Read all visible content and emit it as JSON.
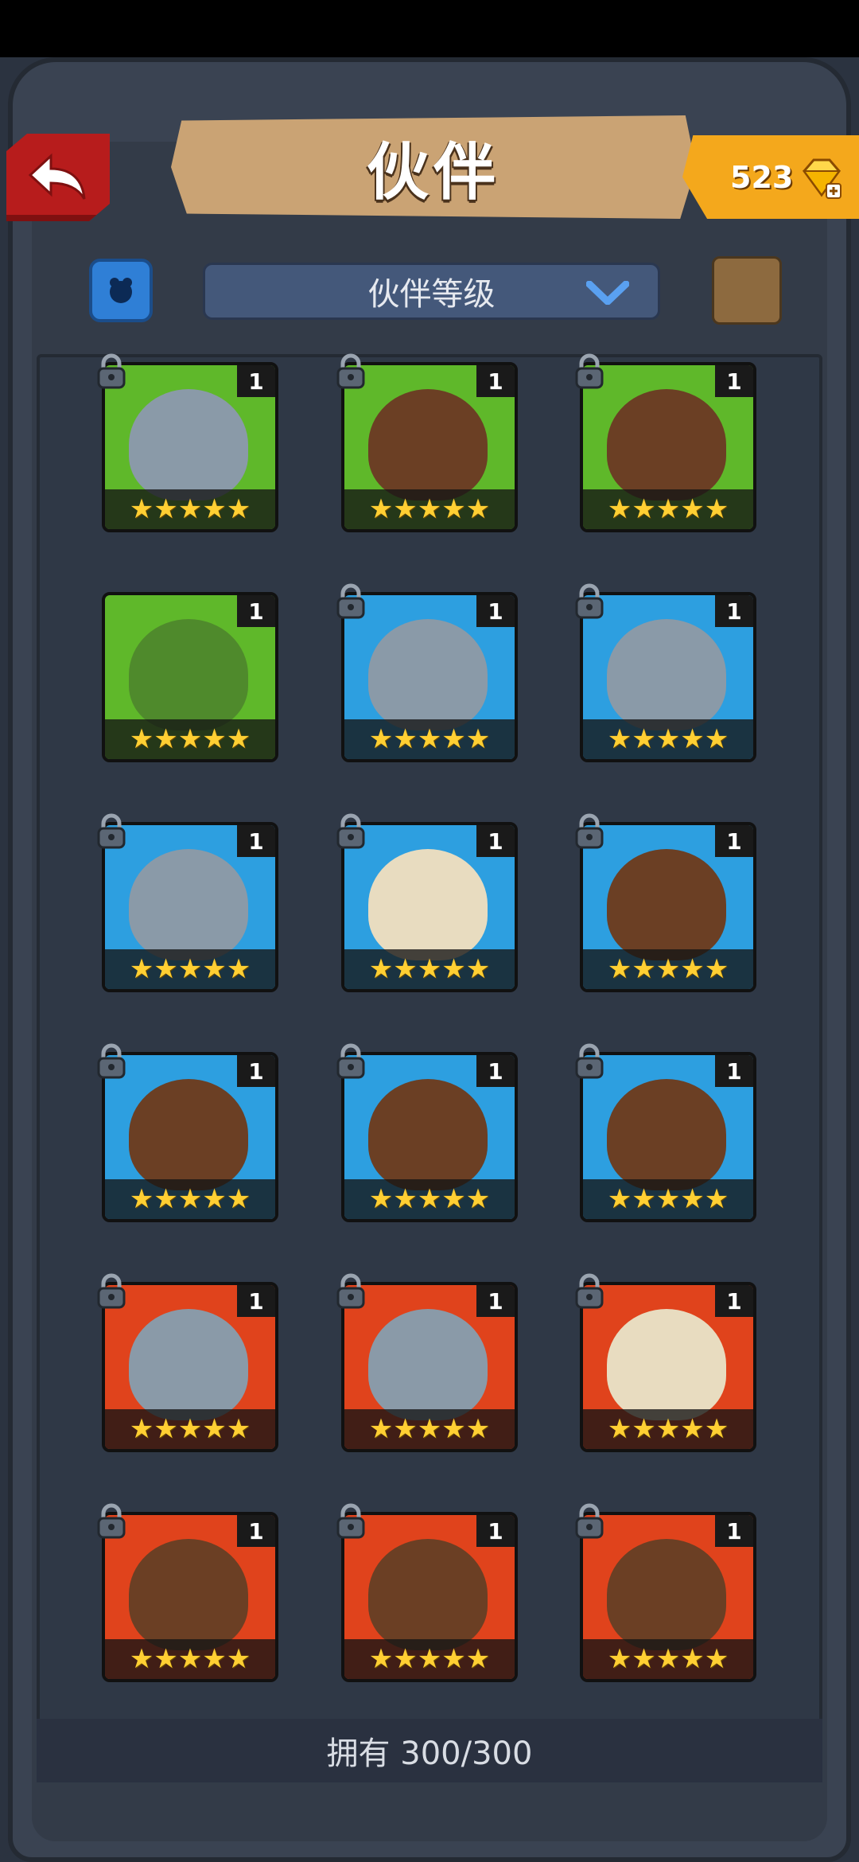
{
  "header": {
    "title": "伙伴",
    "gem_count": "523"
  },
  "filter": {
    "dropdown_label": "伙伴等级"
  },
  "colors": {
    "green": "#5fb82a",
    "blue": "#2d9fe0",
    "red": "#e0431c",
    "star": "#ffcf33"
  },
  "cards": [
    {
      "level": "1",
      "stars": "★★★★★",
      "bg": "green",
      "hero": "elephant-monster",
      "locked": true
    },
    {
      "level": "1",
      "stars": "★★★★★",
      "bg": "green",
      "hero": "bearded-warrior",
      "locked": true
    },
    {
      "level": "1",
      "stars": "★★★★★",
      "bg": "green",
      "hero": "bearded-warrior",
      "locked": true
    },
    {
      "level": "1",
      "stars": "★★★★★",
      "bg": "green",
      "hero": "crocodile-beast",
      "locked": false
    },
    {
      "level": "1",
      "stars": "★★★★★",
      "bg": "blue",
      "hero": "elephant-monster",
      "locked": true
    },
    {
      "level": "1",
      "stars": "★★★★★",
      "bg": "blue",
      "hero": "elephant-monster",
      "locked": true
    },
    {
      "level": "1",
      "stars": "★★★★★",
      "bg": "blue",
      "hero": "elephant-monster",
      "locked": true
    },
    {
      "level": "1",
      "stars": "★★★★★",
      "bg": "blue",
      "hero": "white-haired-heroine",
      "locked": true
    },
    {
      "level": "1",
      "stars": "★★★★★",
      "bg": "blue",
      "hero": "bearded-warrior",
      "locked": true
    },
    {
      "level": "1",
      "stars": "★★★★★",
      "bg": "blue",
      "hero": "bearded-warrior",
      "locked": true
    },
    {
      "level": "1",
      "stars": "★★★★★",
      "bg": "blue",
      "hero": "bearded-warrior",
      "locked": true
    },
    {
      "level": "1",
      "stars": "★★★★★",
      "bg": "blue",
      "hero": "bearded-warrior",
      "locked": true
    },
    {
      "level": "1",
      "stars": "★★★★★",
      "bg": "red",
      "hero": "elephant-monster",
      "locked": true
    },
    {
      "level": "1",
      "stars": "★★★★★",
      "bg": "red",
      "hero": "elephant-monster",
      "locked": true
    },
    {
      "level": "1",
      "stars": "★★★★★",
      "bg": "red",
      "hero": "white-haired-heroine",
      "locked": true
    },
    {
      "level": "1",
      "stars": "★★★★★",
      "bg": "red",
      "hero": "bearded-warrior",
      "locked": true
    },
    {
      "level": "1",
      "stars": "★★★★★",
      "bg": "red",
      "hero": "bearded-warrior",
      "locked": true
    },
    {
      "level": "1",
      "stars": "★★★★★",
      "bg": "red",
      "hero": "bearded-warrior",
      "locked": true
    }
  ],
  "footer": {
    "owned_text": "拥有 300/300"
  }
}
